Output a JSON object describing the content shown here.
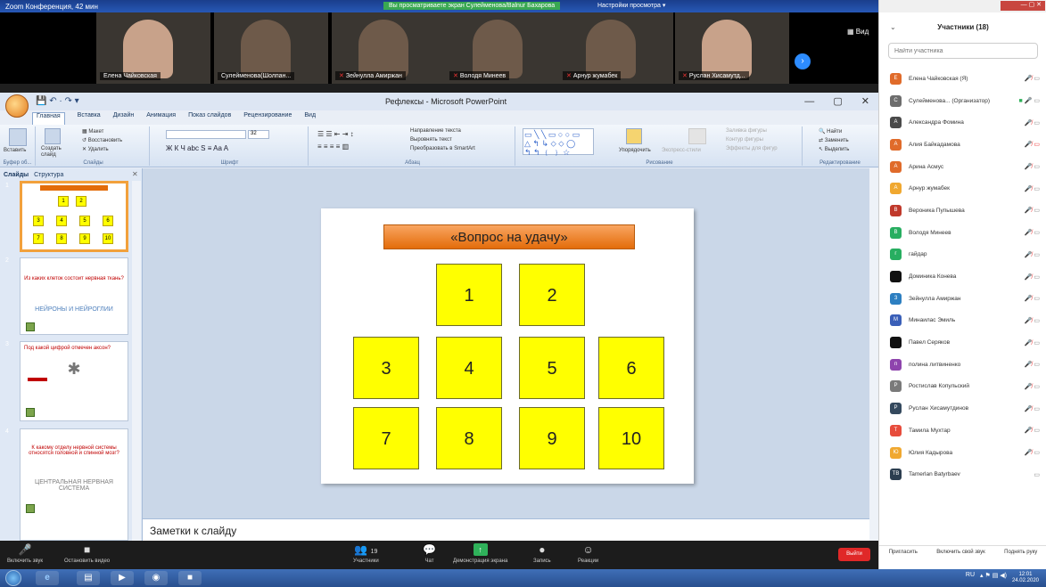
{
  "zoom": {
    "window_title": "Zoom Конференция, 42 мин",
    "share_banner": "Вы просматриваете экран Сулейменова/Balnur Бахарова",
    "view_options": "Настройки просмотра",
    "view_button": "Вид",
    "videos": [
      {
        "name": "Елена Чайковская",
        "muted": false
      },
      {
        "name": "Сулейменова(Шолпан...",
        "muted": false
      },
      {
        "name": "Зейнулла Амиржан",
        "muted": true
      },
      {
        "name": "Володя Минеев",
        "muted": true
      },
      {
        "name": "Арнур жумабек",
        "muted": true
      },
      {
        "name": "Руслан Хисамутд...",
        "muted": true
      }
    ],
    "toolbar": {
      "unmute": "Включить звук",
      "start_video": "Остановить видео",
      "participants": "Участники",
      "participants_count": "19",
      "chat": "Чат",
      "share": "Демонстрация экрана",
      "record": "Запись",
      "reactions": "Реакции",
      "leave": "Выйти"
    }
  },
  "ppt": {
    "title": "Рефлексы - Microsoft PowerPoint",
    "tabs": [
      "Главная",
      "Вставка",
      "Дизайн",
      "Анимация",
      "Показ слайдов",
      "Рецензирование",
      "Вид"
    ],
    "ribbon": {
      "clipboard": {
        "paste": "Вставить",
        "label": "Буфер об..."
      },
      "slides": {
        "new": "Создать слайд",
        "layout": "Макет",
        "reset": "Восстановить",
        "delete": "Удалить",
        "label": "Слайды"
      },
      "font": {
        "label": "Шрифт",
        "size": "32"
      },
      "paragraph": {
        "direction": "Направление текста",
        "align": "Выровнять текст",
        "smartart": "Преобразовать в SmartArt",
        "label": "Абзац"
      },
      "drawing": {
        "arrange": "Упорядочить",
        "quick_styles": "Экспресс-стили",
        "fill": "Заливка фигуры",
        "outline": "Контур фигуры",
        "effects": "Эффекты для фигур",
        "label": "Рисование"
      },
      "editing": {
        "find": "Найти",
        "replace": "Заменить",
        "select": "Выделить",
        "label": "Редактирование"
      }
    },
    "pane_tabs": [
      "Слайды",
      "Структура"
    ],
    "thumbs": {
      "slide1_numbers": [
        "1",
        "2",
        "3",
        "4",
        "5",
        "6",
        "7",
        "8",
        "9",
        "10"
      ],
      "slide2_question": "Из каких клеток состоит нервная ткань?",
      "slide2_answer": "НЕЙРОНЫ И НЕЙРОГЛИИ",
      "slide3_question": "Под какой цифрой отмечен аксон?",
      "slide4_question": "К какому отделу нервной системы относятся головной и спинной мозг?",
      "slide4_answer": "ЦЕНТРАЛЬНАЯ НЕРВНАЯ СИСТЕМА"
    },
    "slide": {
      "title": "«Вопрос на удачу»",
      "cells": [
        "1",
        "2",
        "3",
        "4",
        "5",
        "6",
        "7",
        "8",
        "9",
        "10"
      ]
    },
    "notes_placeholder": "Заметки к слайду"
  },
  "participants": {
    "header": "Участники (18)",
    "search_placeholder": "Найти участника",
    "list": [
      {
        "name": "Елена Чайковская (Я)",
        "initial": "Е",
        "color": "#e06b2a",
        "mic": "muted"
      },
      {
        "name": "Сулейменова... (Организатор)",
        "initial": "С",
        "color": "#6d6d6d",
        "mic": "on"
      },
      {
        "name": "Александра Фомина",
        "initial": "А",
        "color": "#4a4a4a",
        "mic": "muted"
      },
      {
        "name": "Алия Байкадамова",
        "initial": "А",
        "color": "#e06b2a",
        "mic": "muted"
      },
      {
        "name": "Арина Асмус",
        "initial": "А",
        "color": "#e06b2a",
        "mic": "muted"
      },
      {
        "name": "Арнур жумабек",
        "initial": "А",
        "color": "#f0a830",
        "mic": "muted"
      },
      {
        "name": "Вероника Пупышева",
        "initial": "В",
        "color": "#c0392b",
        "mic": "muted"
      },
      {
        "name": "Володя Минеев",
        "initial": "В",
        "color": "#27ae60",
        "mic": "muted"
      },
      {
        "name": "гайдар",
        "initial": "г",
        "color": "#27ae60",
        "mic": "muted"
      },
      {
        "name": "Доминика Конева",
        "initial": "",
        "color": "#111111",
        "mic": "muted"
      },
      {
        "name": "Зейнулла Амиржан",
        "initial": "З",
        "color": "#2d7fc1",
        "mic": "muted"
      },
      {
        "name": "Минаилас Эмиль",
        "initial": "М",
        "color": "#3a5fb8",
        "mic": "muted"
      },
      {
        "name": "Павел Серяков",
        "initial": "",
        "color": "#111111",
        "mic": "muted"
      },
      {
        "name": "полина литвиненко",
        "initial": "п",
        "color": "#8e44ad",
        "mic": "muted"
      },
      {
        "name": "Ростислав Копульский",
        "initial": "Р",
        "color": "#7a7a7a",
        "mic": "muted"
      },
      {
        "name": "Руслан Хисамутдинов",
        "initial": "Р",
        "color": "#34495e",
        "mic": "muted"
      },
      {
        "name": "Тамила Мухтар",
        "initial": "Т",
        "color": "#e74c3c",
        "mic": "muted"
      },
      {
        "name": "Юлия Кадырова",
        "initial": "Ю",
        "color": "#f0a830",
        "mic": "muted"
      },
      {
        "name": "Tamerlan Batyrbaev",
        "initial": "TB",
        "color": "#2c3e50",
        "mic": "video"
      }
    ],
    "footer": {
      "invite": "Пригласить",
      "unmute_self": "Включить свой звук",
      "raise_hand": "Поднять руку"
    }
  },
  "taskbar": {
    "lang": "RU",
    "time": "12:01",
    "date": "24.02.2020"
  }
}
